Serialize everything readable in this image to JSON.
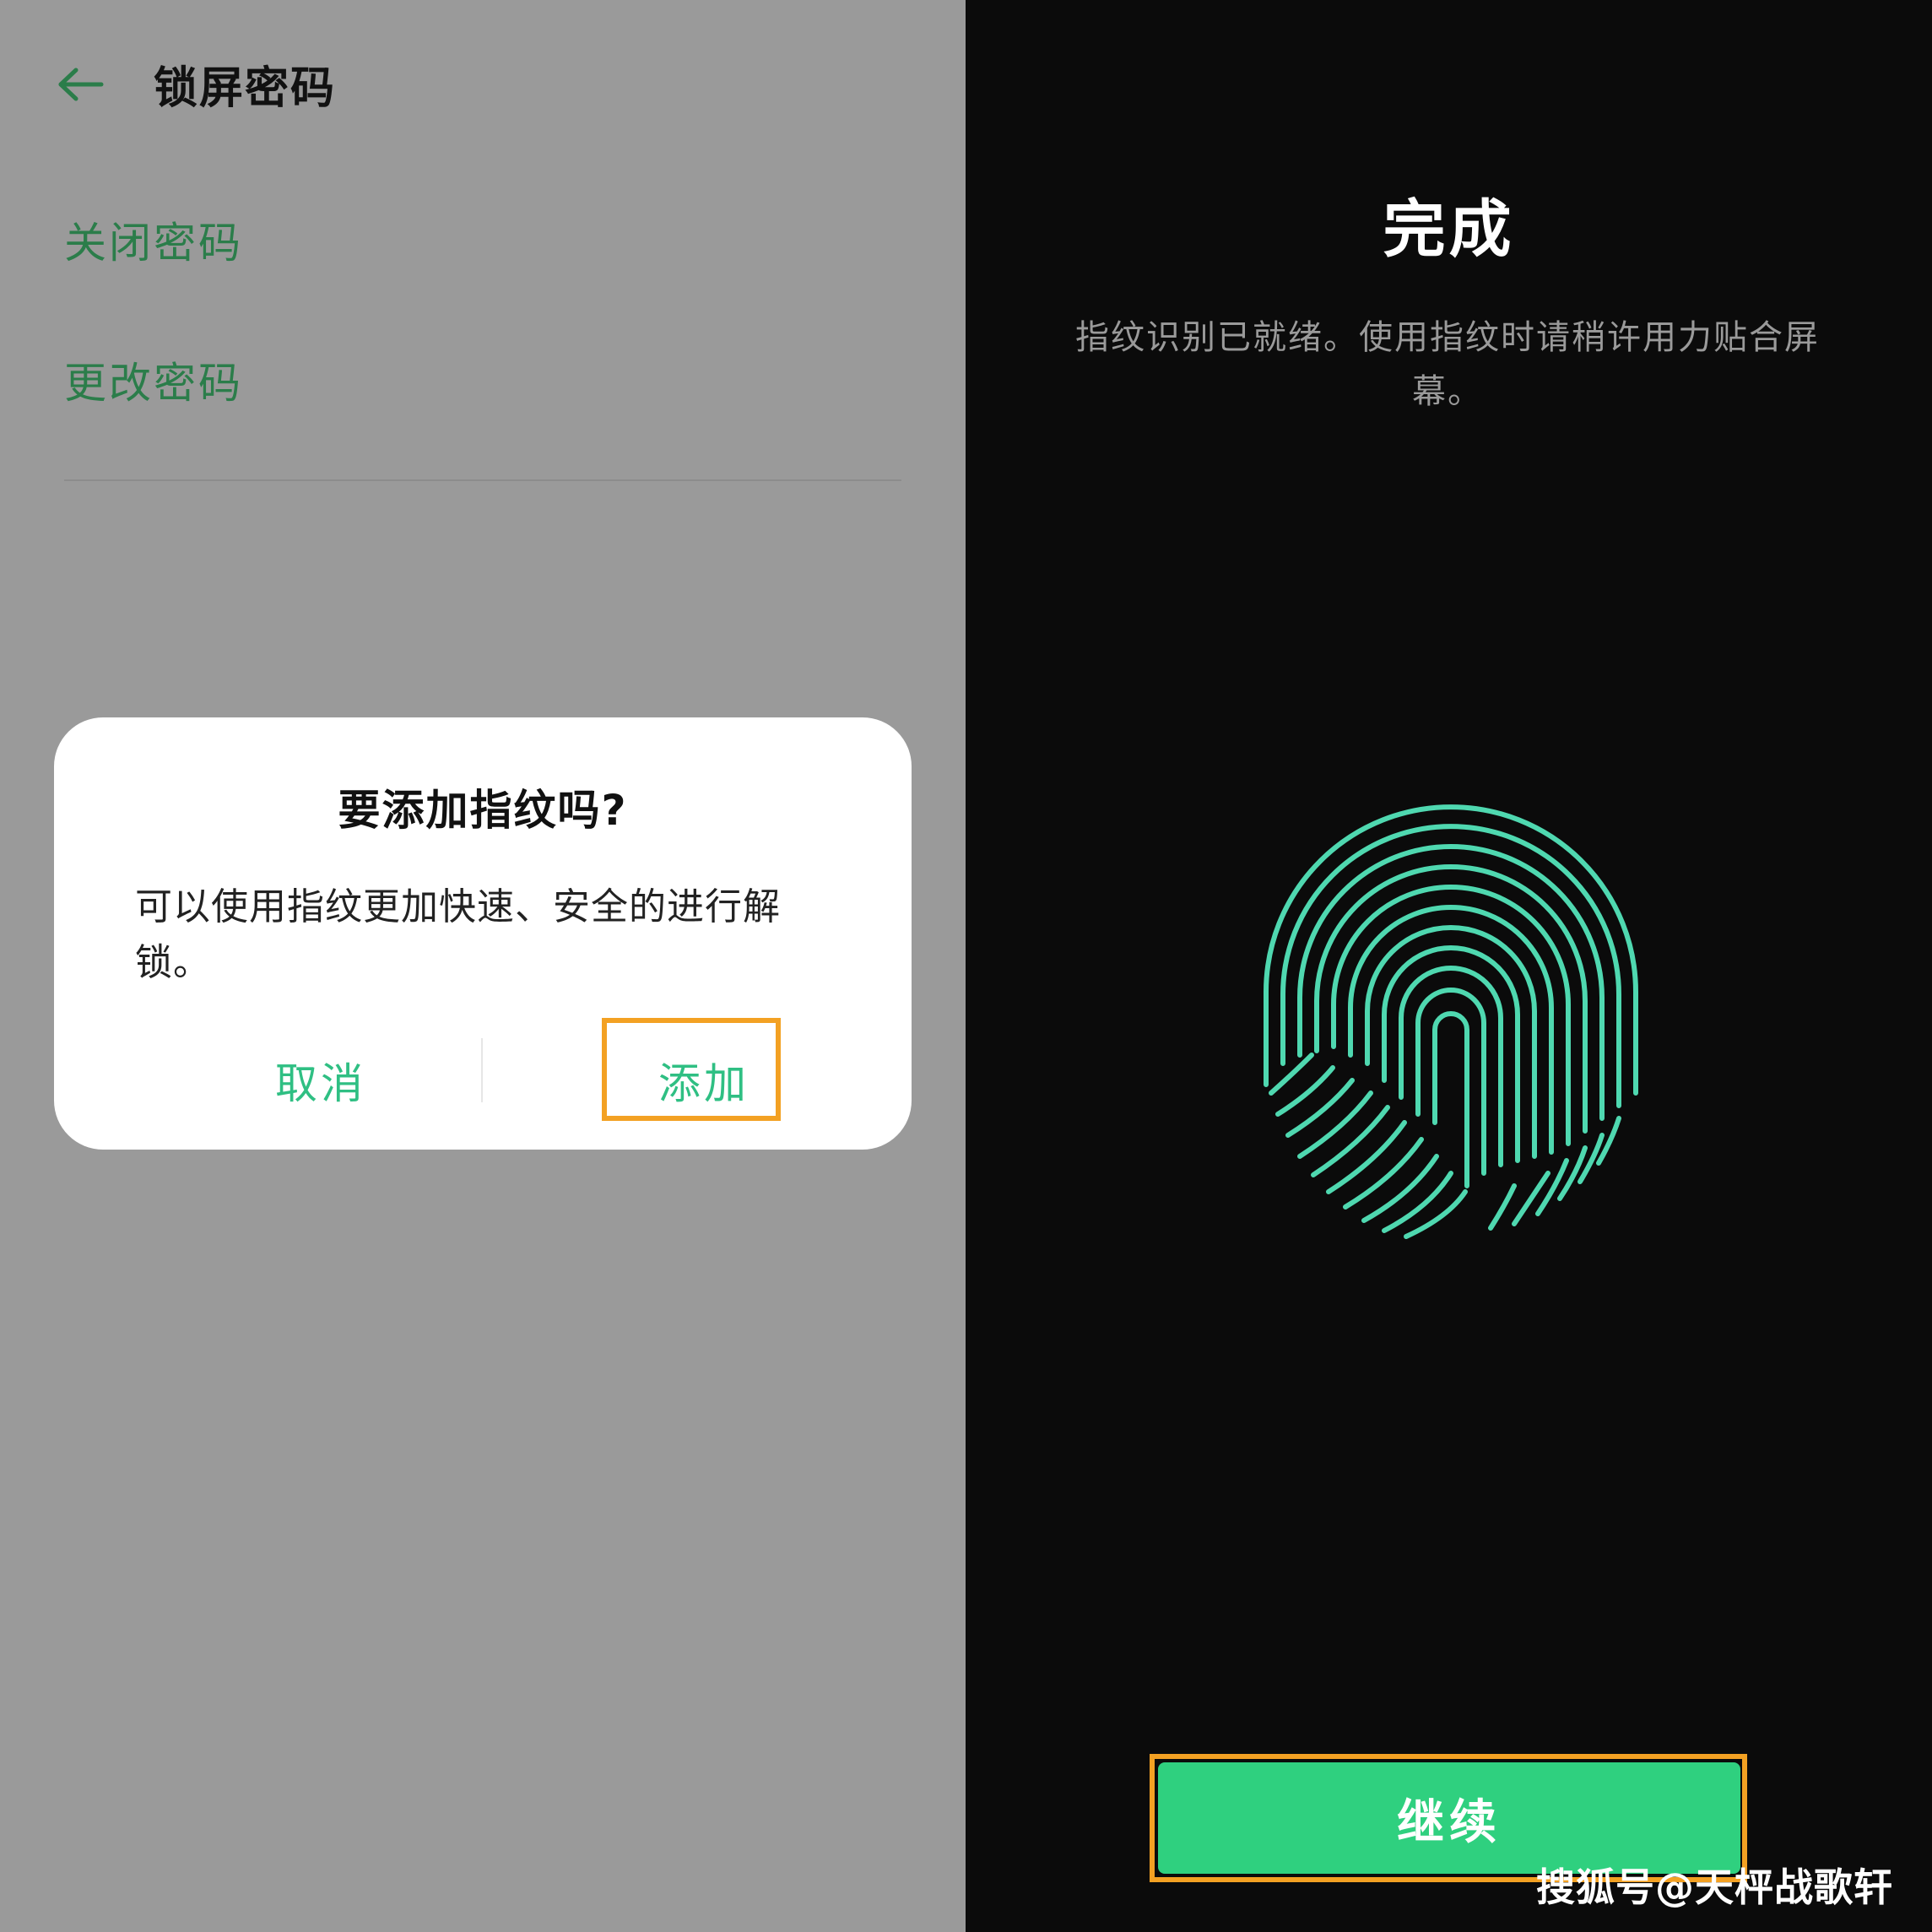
{
  "left": {
    "header": {
      "title": "锁屏密码",
      "back_icon": "arrow-left-icon"
    },
    "menu": [
      {
        "label": "关闭密码"
      },
      {
        "label": "更改密码"
      }
    ],
    "dialog": {
      "title": "要添加指纹吗?",
      "message": "可以使用指纹更加快速、安全的进行解锁。",
      "cancel_label": "取消",
      "add_label": "添加"
    }
  },
  "right": {
    "title": "完成",
    "description": "指纹识别已就绪。使用指纹时请稍许用力贴合屏幕。",
    "fingerprint_icon": "fingerprint-icon",
    "continue_label": "继续"
  },
  "watermark": "搜狐号@天枰战歌轩",
  "colors": {
    "accent_green": "#2fd07f",
    "link_green": "#2b7d4a",
    "dialog_button_green": "#2fbf83",
    "highlight_orange": "#f3a123",
    "fingerprint_teal": "#4fd8b0",
    "left_background": "#9a9a9a",
    "right_background": "#0b0b0b"
  }
}
